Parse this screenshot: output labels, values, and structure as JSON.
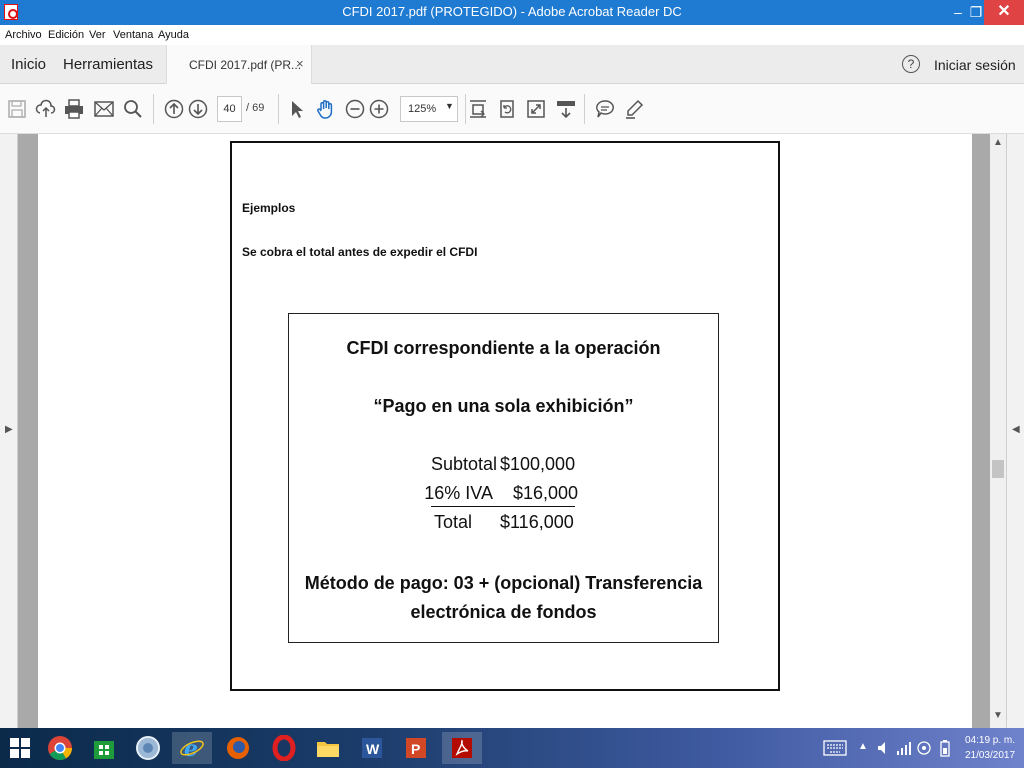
{
  "window": {
    "title": "CFDI 2017.pdf (PROTEGIDO) - Adobe Acrobat Reader DC",
    "min": "‒",
    "max": "❐",
    "close": "✕"
  },
  "menu": [
    "Archivo",
    "Edición",
    "Ver",
    "Ventana",
    "Ayuda"
  ],
  "tabs": {
    "home": "Inicio",
    "tools": "Herramientas",
    "document": "CFDI 2017.pdf (PR...",
    "close": "×",
    "help": "?",
    "signin": "Iniciar sesión"
  },
  "toolbar": {
    "page_current": "40",
    "page_total": "/ 69",
    "zoom": "125%",
    "zoom_caret": "▼"
  },
  "document": {
    "heading1": "Ejemplos",
    "heading2": "Se cobra el total antes de expedir el CFDI",
    "box_title": "CFDI correspondiente a la operación",
    "box_subtitle": "“Pago en una sola exhibición”",
    "subtotal_label": "Subtotal",
    "subtotal_value": "$100,000",
    "iva_label": "16% IVA",
    "iva_value": "$16,000",
    "total_label": "Total",
    "total_value": "$116,000",
    "metodo_line1": "Método de pago: 03 + (opcional) Transferencia",
    "metodo_line2": "electrónica de fondos"
  },
  "panels": {
    "left_arrow": "▶",
    "right_arrow": "◀",
    "scroll_up": "▲",
    "scroll_down": "▼"
  },
  "taskbar": {
    "clock_time": "04:19 p. m.",
    "clock_date": "21/03/2017",
    "tray_chevron": "▲"
  }
}
